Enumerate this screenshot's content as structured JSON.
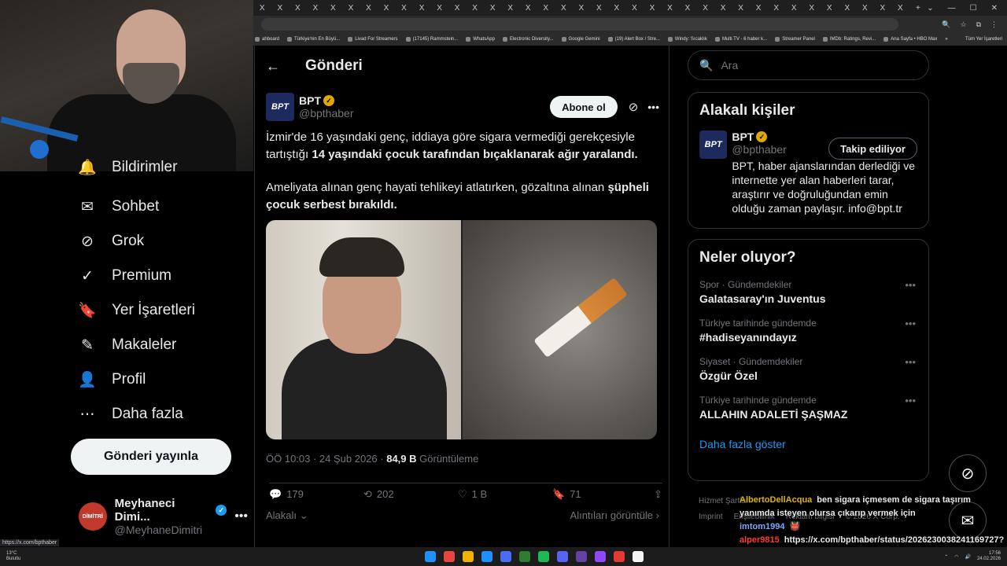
{
  "browser": {
    "tab_glyph": "X",
    "tab_count": 37,
    "new_tab": "+",
    "window_controls": [
      "⌄",
      "—",
      "☐",
      "✕"
    ],
    "bookmarks": [
      "ahboard",
      "Türkiye'nin En Büyü...",
      "Livad For Streamers",
      "(17145) Rammstein...",
      "WhatsApp",
      "Electronic Diversity...",
      "Google Gemini",
      "(19) Alert Box / Stre...",
      "Windy: Sıcaklık",
      "Multi TV - 6 haber k...",
      "Streamer Panel",
      "IMDb: Ratings, Revi...",
      "Ana Sayfa • HBO Max"
    ],
    "bookmarks_more": "»",
    "all_bookmarks": "Tüm Yer İşaretleri"
  },
  "nav": {
    "items": [
      {
        "label": "Bildirimler",
        "icon": "bell-icon",
        "glyph": "🔔"
      },
      {
        "label": "Sohbet",
        "icon": "envelope-icon",
        "glyph": "✉"
      },
      {
        "label": "Grok",
        "icon": "grok-icon",
        "glyph": "⊘"
      },
      {
        "label": "Premium",
        "icon": "verified-badge-icon",
        "glyph": "✓"
      },
      {
        "label": "Yer İşaretleri",
        "icon": "bookmark-icon",
        "glyph": "🔖"
      },
      {
        "label": "Makaleler",
        "icon": "article-icon",
        "glyph": "✎"
      },
      {
        "label": "Profil",
        "icon": "person-icon",
        "glyph": "👤"
      },
      {
        "label": "Daha fazla",
        "icon": "more-circle-icon",
        "glyph": "⋯"
      }
    ],
    "post_button": "Gönderi yayınla",
    "account": {
      "name": "Meyhaneci Dimi...",
      "handle": "@MeyhaneDimitri",
      "avatar_text": "DİMİTRİ"
    }
  },
  "main": {
    "header_title": "Gönderi",
    "back_glyph": "←",
    "author": {
      "name": "BPT",
      "handle": "@bpthaber",
      "logo": "BPT"
    },
    "subscribe": "Abone ol",
    "text1_pre": "İzmir'de 16 yaşındaki genç, iddiaya göre sigara vermediği gerekçesiyle tartıştığı ",
    "text1_bold": "14 yaşındaki çocuk tarafından bıçaklanarak ağır yaralandı.",
    "text2_pre": "Ameliyata alınan genç hayati tehlikeyi atlatırken, gözaltına alınan ",
    "text2_bold": "şüpheli çocuk serbest bırakıldı.",
    "time": "ÖÖ 10:03 · 24 Şub 2026 · ",
    "views": "84,9 B",
    "views_label": " Görüntüleme",
    "actions": {
      "replies": "179",
      "reposts": "202",
      "likes": "1 B",
      "bookmarks": "71"
    },
    "relevance": "Alakalı",
    "quotes": "Alıntıları görüntüle"
  },
  "right": {
    "search_placeholder": "Ara",
    "related": {
      "title": "Alakalı kişiler",
      "name": "BPT",
      "handle": "@bpthaber",
      "following": "Takip ediliyor",
      "bio": "BPT, haber ajanslarından derlediği ve internette yer alan haberleri tarar, araştırır ve doğruluğundan emin olduğu zaman paylaşır. info@bpt.tr"
    },
    "trends": {
      "title": "Neler oluyor?",
      "items": [
        {
          "cat": "Spor · Gündemdekiler",
          "name": "Galatasaray'ın Juventus"
        },
        {
          "cat": "Türkiye tarihinde gündemde",
          "name": "#hadiseyanındayız"
        },
        {
          "cat": "Siyaset · Gündemdekiler",
          "name": "Özgür Özel"
        },
        {
          "cat": "Türkiye tarihinde gündemde",
          "name": "ALLAHIN ADALETİ ŞAŞMAZ"
        }
      ],
      "more": "Daha fazla göster"
    },
    "footer": [
      "Hizmet Şartları",
      "Imprint",
      "Erişilebilirlik",
      "Reklam bilgisi",
      "© 2026 X Corp."
    ]
  },
  "chat": [
    {
      "user": "AlbertoDellAcqua",
      "color": "#e0b400",
      "msg": "ben sigara içmesem de sigara taşırım yanımda isteyen olursa çıkarıp vermek için"
    },
    {
      "user": "imtom1994",
      "color": "#7aa7ff",
      "msg": "👹"
    },
    {
      "user": "alper9815",
      "color": "#ff3b3b",
      "msg": "https://x.com/bpthaber/status/2026230038241169727?s=46"
    }
  ],
  "status_url": "https://x.com/bpthaber",
  "taskbar": {
    "weather_temp": "13°C",
    "weather_desc": "Bulutlu",
    "time": "17:56",
    "date": "24.02.2026",
    "app_colors": [
      "#1e90ff",
      "#e8453c",
      "#f0b400",
      "#1e90ff",
      "#4a6cf7",
      "#2e7d32",
      "#1db954",
      "#5865f2",
      "#6441a5",
      "#9146ff",
      "#e53935",
      "#f4f4f4"
    ]
  }
}
